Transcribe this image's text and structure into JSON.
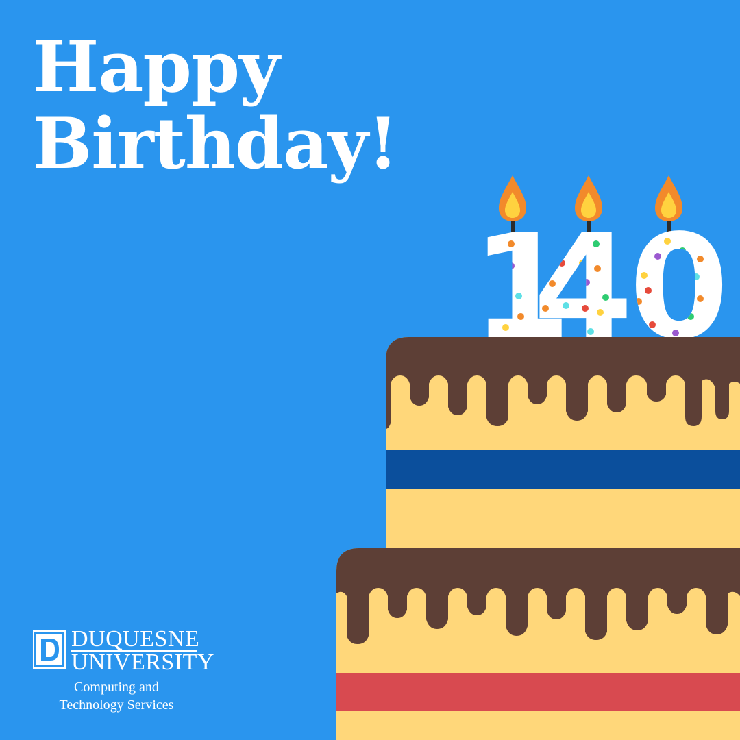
{
  "headline": {
    "line1": "Happy",
    "line2": "Birthday!"
  },
  "cake": {
    "number": "140",
    "candle_count": 3,
    "colors": {
      "background": "#2a95ee",
      "frosting": "#5d3f36",
      "cake": "#ffd77a",
      "top_stripe": "#0b4f9c",
      "bottom_stripe": "#d84a50",
      "flame_outer": "#f28a2b",
      "flame_inner": "#ffd23f"
    }
  },
  "logo": {
    "name_line1": "DUQUESNE",
    "name_line2": "UNIVERSITY",
    "subtitle_line1": "Computing and",
    "subtitle_line2": "Technology Services"
  }
}
